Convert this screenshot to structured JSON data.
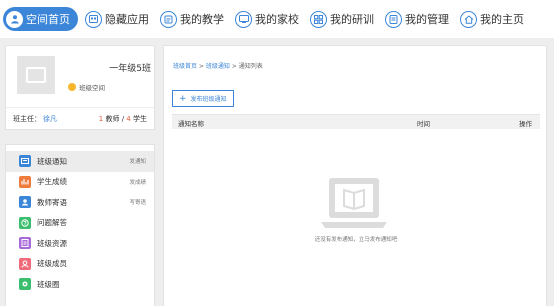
{
  "nav": {
    "items": [
      {
        "label": "空间首页",
        "icon": "user-icon",
        "active": true
      },
      {
        "label": "隐藏应用",
        "icon": "apps-icon"
      },
      {
        "label": "我的教学",
        "icon": "teaching-icon"
      },
      {
        "label": "我的家校",
        "icon": "home-school-icon"
      },
      {
        "label": "我的研训",
        "icon": "research-icon"
      },
      {
        "label": "我的管理",
        "icon": "management-icon"
      },
      {
        "label": "我的主页",
        "icon": "home-icon"
      }
    ],
    "accent": "#3b86d8"
  },
  "class_card": {
    "name": "一年级5班",
    "space_label": "班级空间",
    "teacher_label": "班主任：",
    "teacher_name": "徐凡",
    "teacher_count": "1",
    "teacher_unit": "教师 / ",
    "student_count": "4",
    "student_unit": "学生"
  },
  "menu": {
    "items": [
      {
        "label": "班级通知",
        "sub": "发通知",
        "color": "#3b86d8",
        "icon": "notice-icon"
      },
      {
        "label": "学生成绩",
        "sub": "发成绩",
        "color": "#f07c3c",
        "icon": "chart-icon"
      },
      {
        "label": "教师寄语",
        "sub": "写寄语",
        "color": "#3b86d8",
        "icon": "teacher-icon"
      },
      {
        "label": "问题解答",
        "sub": "",
        "color": "#3bbf6e",
        "icon": "question-icon"
      },
      {
        "label": "班级资源",
        "sub": "",
        "color": "#a86ad8",
        "icon": "resource-icon"
      },
      {
        "label": "班级成员",
        "sub": "",
        "color": "#f06a7a",
        "icon": "member-icon"
      },
      {
        "label": "班级圈",
        "sub": "",
        "color": "#3bbf6e",
        "icon": "circle-icon"
      }
    ]
  },
  "main": {
    "breadcrumb": {
      "home": "班级首页",
      "sep": " > ",
      "notice": "班级通知",
      "current": "通知列表"
    },
    "publish_button": "发布班级通知",
    "table": {
      "col_name": "通知名称",
      "col_time": "时间",
      "col_action": "操作"
    },
    "empty_text": "还没有发布通知，立马发布通知吧"
  }
}
